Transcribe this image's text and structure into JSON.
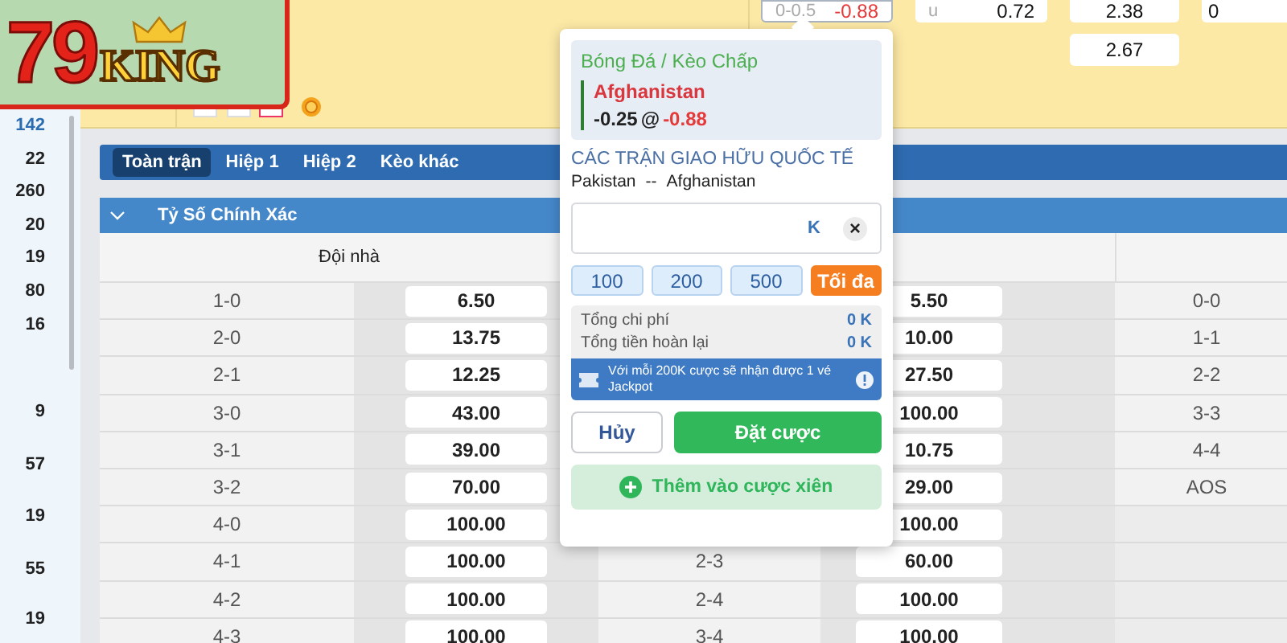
{
  "logo": {
    "number": "79",
    "word": "KING"
  },
  "sidebar": {
    "counts": [
      {
        "text": "142",
        "selected": true
      },
      {
        "text": "22",
        "selected": false
      },
      {
        "text": "260",
        "selected": false
      },
      {
        "text": "20",
        "selected": false
      },
      {
        "text": "19",
        "selected": false
      },
      {
        "text": "80",
        "selected": false
      },
      {
        "text": "16",
        "selected": false
      },
      {
        "text": "9",
        "selected": false
      },
      {
        "text": "57",
        "selected": false
      },
      {
        "text": "19",
        "selected": false
      },
      {
        "text": "55",
        "selected": false
      },
      {
        "text": "19",
        "selected": false
      }
    ]
  },
  "header_odds": [
    {
      "cells": [
        {
          "line": "0-0.5",
          "price": "-0.88",
          "negative": true,
          "selected": true
        }
      ]
    },
    {
      "cells": [
        {
          "line": "u",
          "price": "0.72",
          "negative": false,
          "selected": false
        }
      ]
    },
    {
      "cells": [
        {
          "price": "2.38",
          "negative": false,
          "selected": false
        },
        {
          "price": "2.67",
          "negative": false,
          "selected": false
        }
      ]
    },
    {
      "cells": [
        {
          "price": "0",
          "negative": false,
          "selected": false
        }
      ]
    }
  ],
  "tabs": [
    {
      "label": "Toàn trận",
      "selected": true
    },
    {
      "label": "Hiệp 1",
      "selected": false
    },
    {
      "label": "Hiệp 2",
      "selected": false
    },
    {
      "label": "Kèo khác",
      "selected": false
    }
  ],
  "section": {
    "title": "Tỷ Số Chính Xác",
    "expanded": true
  },
  "table": {
    "home_heading": "Đội nhà",
    "rows": [
      {
        "score_1": "1-0",
        "odds_1": "6.50",
        "odds_2": "5.50",
        "score_3": "0-0"
      },
      {
        "score_1": "2-0",
        "odds_1": "13.75",
        "odds_2": "10.00",
        "score_3": "1-1"
      },
      {
        "score_1": "2-1",
        "odds_1": "12.25",
        "odds_2": "27.50",
        "score_3": "2-2"
      },
      {
        "score_1": "3-0",
        "odds_1": "43.00",
        "odds_2": "100.00",
        "score_3": "3-3"
      },
      {
        "score_1": "3-1",
        "odds_1": "39.00",
        "odds_2": "10.75",
        "score_3": "4-4"
      },
      {
        "score_1": "3-2",
        "odds_1": "70.00",
        "odds_2": "29.00",
        "score_3": "AOS"
      },
      {
        "score_1": "4-0",
        "odds_1": "100.00",
        "odds_2": "100.00"
      },
      {
        "score_1": "4-1",
        "odds_1": "100.00",
        "score_2": "2-3",
        "odds_2": "60.00"
      },
      {
        "score_1": "4-2",
        "odds_1": "100.00",
        "score_2": "2-4",
        "odds_2": "100.00"
      },
      {
        "score_1": "4-3",
        "odds_1": "100.00",
        "score_2": "3-4",
        "odds_2": "100.00"
      }
    ]
  },
  "bet_slip": {
    "market": "Bóng Đá / Kèo Chấp",
    "selection": "Afghanistan",
    "line": "-0.25",
    "at": "@",
    "price": "-0.88",
    "league": "CÁC TRẬN GIAO HỮU QUỐC TẾ",
    "home": "Pakistan",
    "separator": "--",
    "away": "Afghanistan",
    "stake_unit": "K",
    "clear": "×",
    "quick_amounts": [
      {
        "label": "100",
        "kind": "amount"
      },
      {
        "label": "200",
        "kind": "amount"
      },
      {
        "label": "500",
        "kind": "amount"
      },
      {
        "label": "Tối đa",
        "kind": "max"
      }
    ],
    "totals": [
      {
        "label": "Tổng chi phí",
        "value": "0 K"
      },
      {
        "label": "Tổng tiền hoàn lại",
        "value": "0 K"
      }
    ],
    "notice": "Với mỗi 200K cược sẽ nhận được 1 vé Jackpot",
    "cancel": "Hủy",
    "place": "Đặt cược",
    "parlay": {
      "label": "Thêm vào cược xiên",
      "disabled": true
    }
  }
}
